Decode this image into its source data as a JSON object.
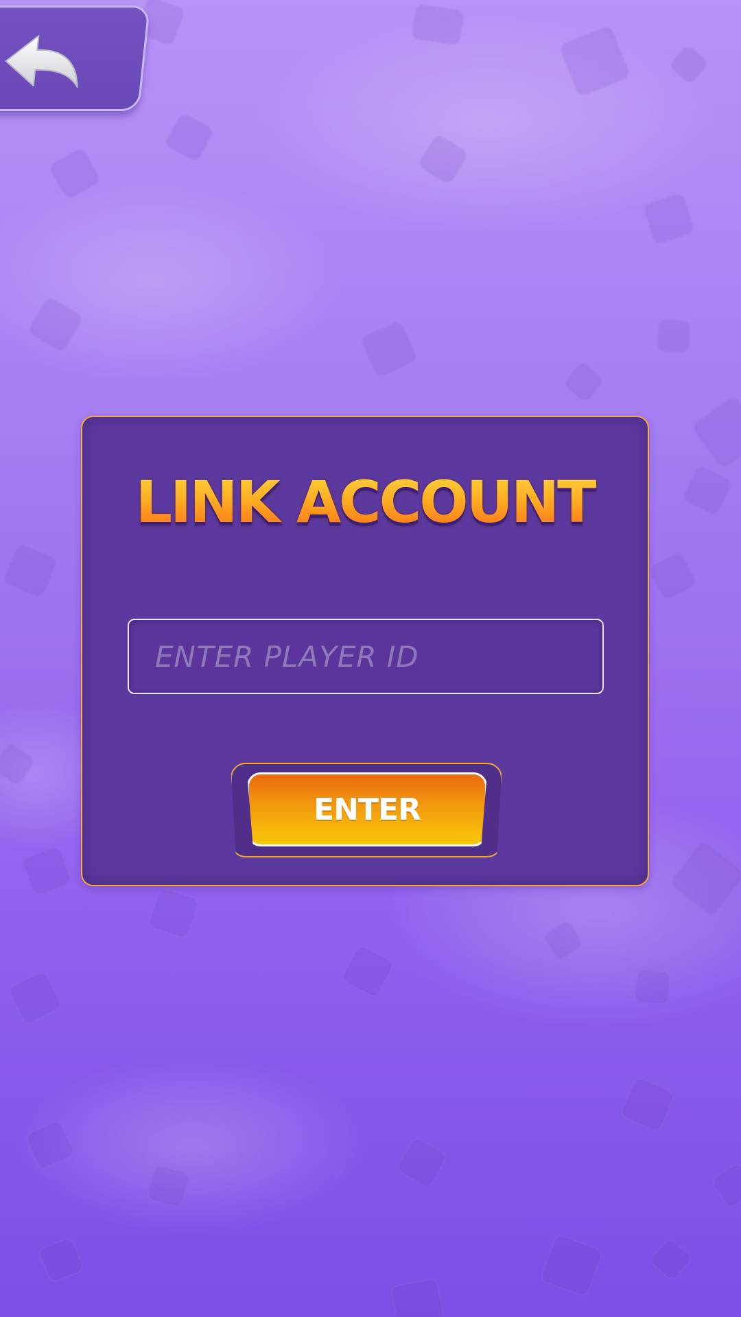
{
  "screen": {
    "name": "link-account",
    "colors": {
      "background_top": "#b693f6",
      "background_bottom": "#7d4fe6",
      "panel": "#5c399e",
      "panel_border": "#f2a93a",
      "title_gradient": [
        "#ffd23c",
        "#ff7417"
      ],
      "button_gradient": [
        "#ea6a10",
        "#f8c806"
      ]
    }
  },
  "header": {
    "back_button": {
      "icon": "back-arrow-icon"
    }
  },
  "panel": {
    "title": "LINK ACCOUNT",
    "player_id_input": {
      "value": "",
      "placeholder": "ENTER PLAYER ID"
    },
    "enter_button": {
      "label": "ENTER"
    }
  }
}
